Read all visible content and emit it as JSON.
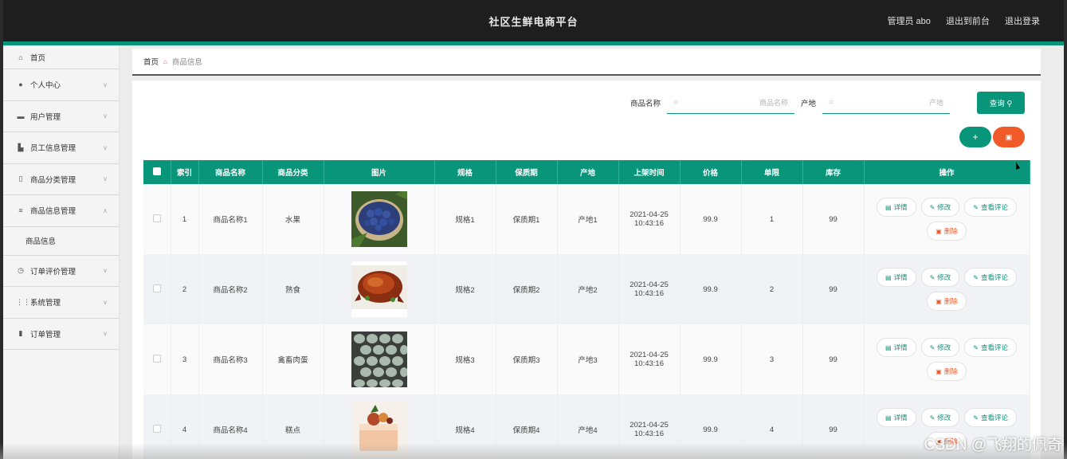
{
  "header": {
    "title": "社区生鲜电商平台",
    "user": "管理员 abo",
    "to_front": "退出到前台",
    "logout": "退出登录"
  },
  "sidebar": {
    "items": [
      {
        "label": "首页",
        "icon": "home-icon"
      },
      {
        "label": "个人中心",
        "icon": "user-icon"
      },
      {
        "label": "用户管理",
        "icon": "users-icon"
      },
      {
        "label": "员工信息管理",
        "icon": "staff-icon"
      },
      {
        "label": "商品分类管理",
        "icon": "category-icon"
      },
      {
        "label": "商品信息管理",
        "icon": "list-icon"
      },
      {
        "label": "订单评价管理",
        "icon": "review-icon"
      },
      {
        "label": "系统管理",
        "icon": "grid-icon"
      },
      {
        "label": "订单管理",
        "icon": "chart-icon"
      }
    ],
    "sub_item": "商品信息"
  },
  "breadcrumb": {
    "home": "首页",
    "current": "商品信息"
  },
  "search": {
    "name_label": "商品名称",
    "name_placeholder": "商品名称",
    "origin_label": "产地",
    "origin_placeholder": "产地",
    "query_button": "查询"
  },
  "table": {
    "headers": [
      "索引",
      "商品名称",
      "商品分类",
      "图片",
      "规格",
      "保质期",
      "产地",
      "上架时间",
      "价格",
      "单限",
      "库存",
      "操作"
    ],
    "rows": [
      {
        "index": "1",
        "name": "商品名称1",
        "category": "水果",
        "spec": "规格1",
        "shelf": "保质期1",
        "origin": "产地1",
        "date": "2021-04-25",
        "time": "10:43:16",
        "price": "99.9",
        "limit": "1",
        "stock": "99",
        "image": "blueberries-image"
      },
      {
        "index": "2",
        "name": "商品名称2",
        "category": "熟食",
        "spec": "规格2",
        "shelf": "保质期2",
        "origin": "产地2",
        "date": "2021-04-25",
        "time": "10:43:16",
        "price": "99.9",
        "limit": "2",
        "stock": "99",
        "image": "roast-chicken-image"
      },
      {
        "index": "3",
        "name": "商品名称3",
        "category": "禽畜肉蛋",
        "spec": "规格3",
        "shelf": "保质期3",
        "origin": "产地3",
        "date": "2021-04-25",
        "time": "10:43:16",
        "price": "99.9",
        "limit": "3",
        "stock": "99",
        "image": "eggs-image"
      },
      {
        "index": "4",
        "name": "商品名称4",
        "category": "糕点",
        "spec": "规格4",
        "shelf": "保质期4",
        "origin": "产地4",
        "date": "2021-04-25",
        "time": "10:43:16",
        "price": "99.9",
        "limit": "4",
        "stock": "99",
        "image": "cake-image"
      }
    ],
    "ops": {
      "detail": "详情",
      "edit": "修改",
      "reviews": "查看评论",
      "delete": "删除"
    }
  },
  "colors": {
    "accent": "#08957a",
    "danger": "#f05a28",
    "topbar": "#1e1e1e"
  },
  "watermark": "CSDN @飞翔的佩奇"
}
